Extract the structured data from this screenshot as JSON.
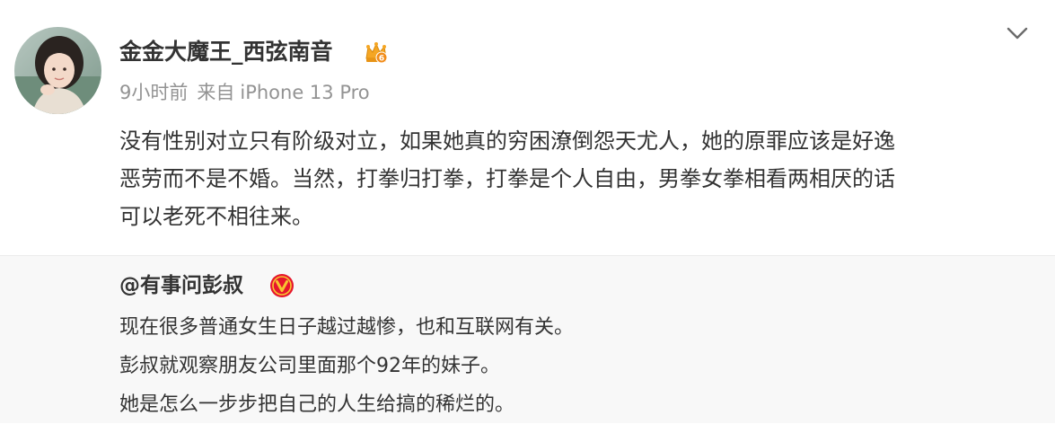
{
  "post": {
    "author": {
      "name": "金金大魔王_西弦南音",
      "badge_icon": "vip-crown-icon"
    },
    "meta": {
      "time": "9小时前",
      "from_label": "来自",
      "device": "iPhone 13 Pro"
    },
    "menu_icon": "chevron-down-icon",
    "text_lines": [
      "没有性别对立只有阶级对立，如果她真的穷困潦倒怨天尤人，她的原罪应该是好逸",
      "恶劳而不是不婚。当然，打拳归打拳，打拳是个人自由，男拳女拳相看两相厌的话",
      "可以老死不相往来。"
    ]
  },
  "repost": {
    "author": "@有事问彭叔",
    "badge_icon": "verified-v-icon",
    "text_lines": [
      "现在很多普通女生日子越过越惨，也和互联网有关。",
      "彭叔就观察朋友公司里面那个92年的妹子。",
      "她是怎么一步步把自己的人生给搞的稀烂的。"
    ]
  },
  "colors": {
    "text": "#333333",
    "meta": "#939393",
    "repost_bg": "#f8f8f8",
    "verified": "#e6162d",
    "vip_gold": "#f5a623"
  }
}
